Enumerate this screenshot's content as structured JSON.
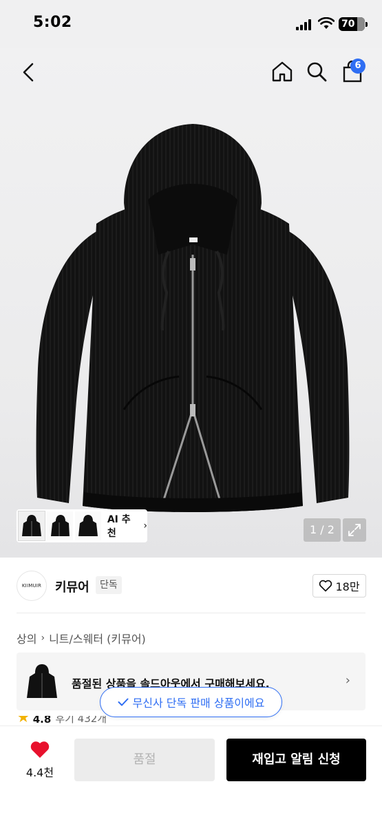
{
  "status_bar": {
    "time": "5:02",
    "battery": "70",
    "battery_level_percent": 70
  },
  "header": {
    "cart_count": "6"
  },
  "gallery": {
    "ai_label": "AI 추천",
    "pager": "1 / 2"
  },
  "brand": {
    "logo_text": "KIIMUIR",
    "name": "키뮤어",
    "tag": "단독",
    "likes": "18만"
  },
  "breadcrumb": {
    "items": [
      "상의",
      "니트/스웨터 (키뮤어)"
    ]
  },
  "soldout_banner": {
    "text": "품절된 상품을 솔드아웃에서 구매해보세요."
  },
  "exclusive_pill": {
    "text": "무신사 단독 판매 상품이에요"
  },
  "rating": {
    "score": "4.8",
    "reviews": "후기 432개"
  },
  "bottom_bar": {
    "heart_count": "4.4천",
    "soldout_label": "품절",
    "restock_label": "재입고 알림 신청"
  },
  "colors": {
    "accent": "#2f6ef3",
    "heart": "#e8112d",
    "primary_button": "#000000",
    "disabled_button": "#ececec"
  }
}
